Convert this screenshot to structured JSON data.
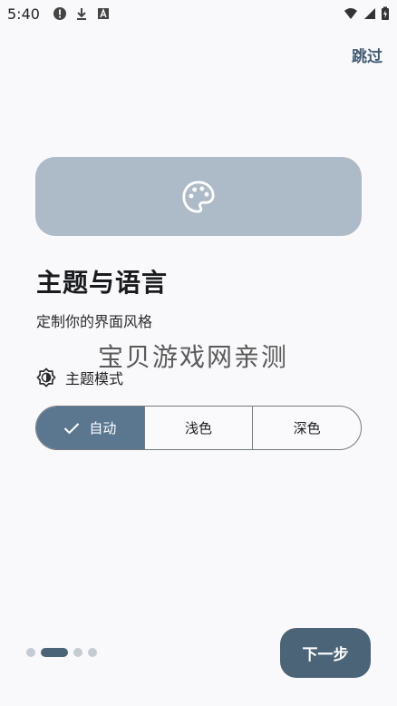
{
  "status_bar": {
    "time": "5:40",
    "left_icons": [
      "alert-circle-icon",
      "download-icon",
      "a-box-icon"
    ],
    "right_icons": [
      "wifi-icon",
      "signal-icon",
      "battery-charging-icon"
    ]
  },
  "header": {
    "skip_label": "跳过"
  },
  "hero": {
    "icon": "palette-icon",
    "background_color": "#adbac7"
  },
  "main": {
    "title": "主题与语言",
    "subtitle": "定制你的界面风格",
    "watermark": "宝贝游戏网亲测"
  },
  "theme_mode": {
    "label": "主题模式",
    "icon": "brightness-icon",
    "options": [
      {
        "label": "自动",
        "selected": true
      },
      {
        "label": "浅色",
        "selected": false
      },
      {
        "label": "深色",
        "selected": false
      }
    ],
    "accent_color": "#5b7790"
  },
  "footer": {
    "pager_total": 4,
    "pager_active_index": 1,
    "next_label": "下一步",
    "next_color": "#4b6478"
  }
}
